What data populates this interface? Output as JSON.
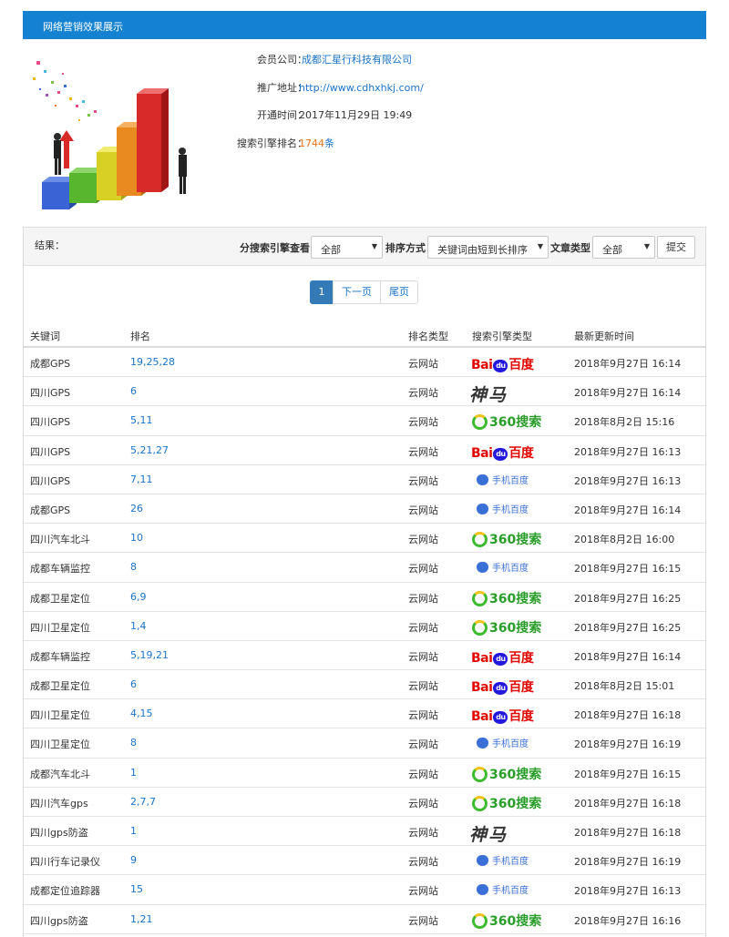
{
  "header": {
    "title": "网络营销效果展示"
  },
  "info": {
    "company_label": "会员公司：",
    "company_value": "成都汇星行科技有限公司",
    "url_label": "推广地址：",
    "url_value": "http://www.cdhxhkj.com/",
    "open_label": "开通时间：",
    "open_value": "2017年11月29日 19:49",
    "rank_label": "搜索引擎排名：",
    "rank_value": "1744",
    "rank_suffix": "条"
  },
  "filter": {
    "result_label": "结果：",
    "engine_label": "分搜索引擎查看",
    "engine_selected": "全部",
    "sort_label": "排序方式",
    "sort_selected": "关键词由短到长排序",
    "article_label": "文章类型",
    "article_selected": "全部",
    "submit_label": "提交"
  },
  "pager": {
    "current": "1",
    "next": "下一页",
    "last": "尾页"
  },
  "table": {
    "headers": [
      "关键词",
      "排名",
      "排名类型",
      "搜索引擎类型",
      "最新更新时间"
    ],
    "rows": [
      {
        "kw": "成都GPS",
        "rank": "19,25,28",
        "type": "云网站",
        "engine": "baidu",
        "time": "2018年9月27日 16:14"
      },
      {
        "kw": "四川GPS",
        "rank": "6",
        "type": "云网站",
        "engine": "shenma",
        "time": "2018年9月27日 16:14"
      },
      {
        "kw": "四川GPS",
        "rank": "5,11",
        "type": "云网站",
        "engine": "360",
        "time": "2018年8月2日 15:16"
      },
      {
        "kw": "四川GPS",
        "rank": "5,21,27",
        "type": "云网站",
        "engine": "baidu",
        "time": "2018年9月27日 16:13"
      },
      {
        "kw": "四川GPS",
        "rank": "7,11",
        "type": "云网站",
        "engine": "mbaidu",
        "time": "2018年9月27日 16:13"
      },
      {
        "kw": "成都GPS",
        "rank": "26",
        "type": "云网站",
        "engine": "mbaidu",
        "time": "2018年9月27日 16:14"
      },
      {
        "kw": "四川汽车北斗",
        "rank": "10",
        "type": "云网站",
        "engine": "360",
        "time": "2018年8月2日 16:00"
      },
      {
        "kw": "成都车辆监控",
        "rank": "8",
        "type": "云网站",
        "engine": "mbaidu",
        "time": "2018年9月27日 16:15"
      },
      {
        "kw": "成都卫星定位",
        "rank": "6,9",
        "type": "云网站",
        "engine": "360",
        "time": "2018年9月27日 16:25"
      },
      {
        "kw": "四川卫星定位",
        "rank": "1,4",
        "type": "云网站",
        "engine": "360",
        "time": "2018年9月27日 16:25"
      },
      {
        "kw": "成都车辆监控",
        "rank": "5,19,21",
        "type": "云网站",
        "engine": "baidu",
        "time": "2018年9月27日 16:14"
      },
      {
        "kw": "成都卫星定位",
        "rank": "6",
        "type": "云网站",
        "engine": "baidu",
        "time": "2018年8月2日 15:01"
      },
      {
        "kw": "四川卫星定位",
        "rank": "4,15",
        "type": "云网站",
        "engine": "baidu",
        "time": "2018年9月27日 16:18"
      },
      {
        "kw": "四川卫星定位",
        "rank": "8",
        "type": "云网站",
        "engine": "mbaidu",
        "time": "2018年9月27日 16:19"
      },
      {
        "kw": "成都汽车北斗",
        "rank": "1",
        "type": "云网站",
        "engine": "360",
        "time": "2018年9月27日 16:15"
      },
      {
        "kw": "四川汽车gps",
        "rank": "2,7,7",
        "type": "云网站",
        "engine": "360",
        "time": "2018年9月27日 16:18"
      },
      {
        "kw": "四川gps防盗",
        "rank": "1",
        "type": "云网站",
        "engine": "shenma",
        "time": "2018年9月27日 16:18"
      },
      {
        "kw": "四川行车记录仪",
        "rank": "9",
        "type": "云网站",
        "engine": "mbaidu",
        "time": "2018年9月27日 16:19"
      },
      {
        "kw": "成都定位追踪器",
        "rank": "15",
        "type": "云网站",
        "engine": "mbaidu",
        "time": "2018年9月27日 16:13"
      },
      {
        "kw": "四川gps防盗",
        "rank": "1,21",
        "type": "云网站",
        "engine": "360",
        "time": "2018年9月27日 16:16"
      }
    ]
  },
  "logos": {
    "baidu_left": "Bai",
    "baidu_paw": "du",
    "baidu_right": "百度",
    "shenma": "神马",
    "so360": "360搜索",
    "mbaidu": "手机百度"
  }
}
